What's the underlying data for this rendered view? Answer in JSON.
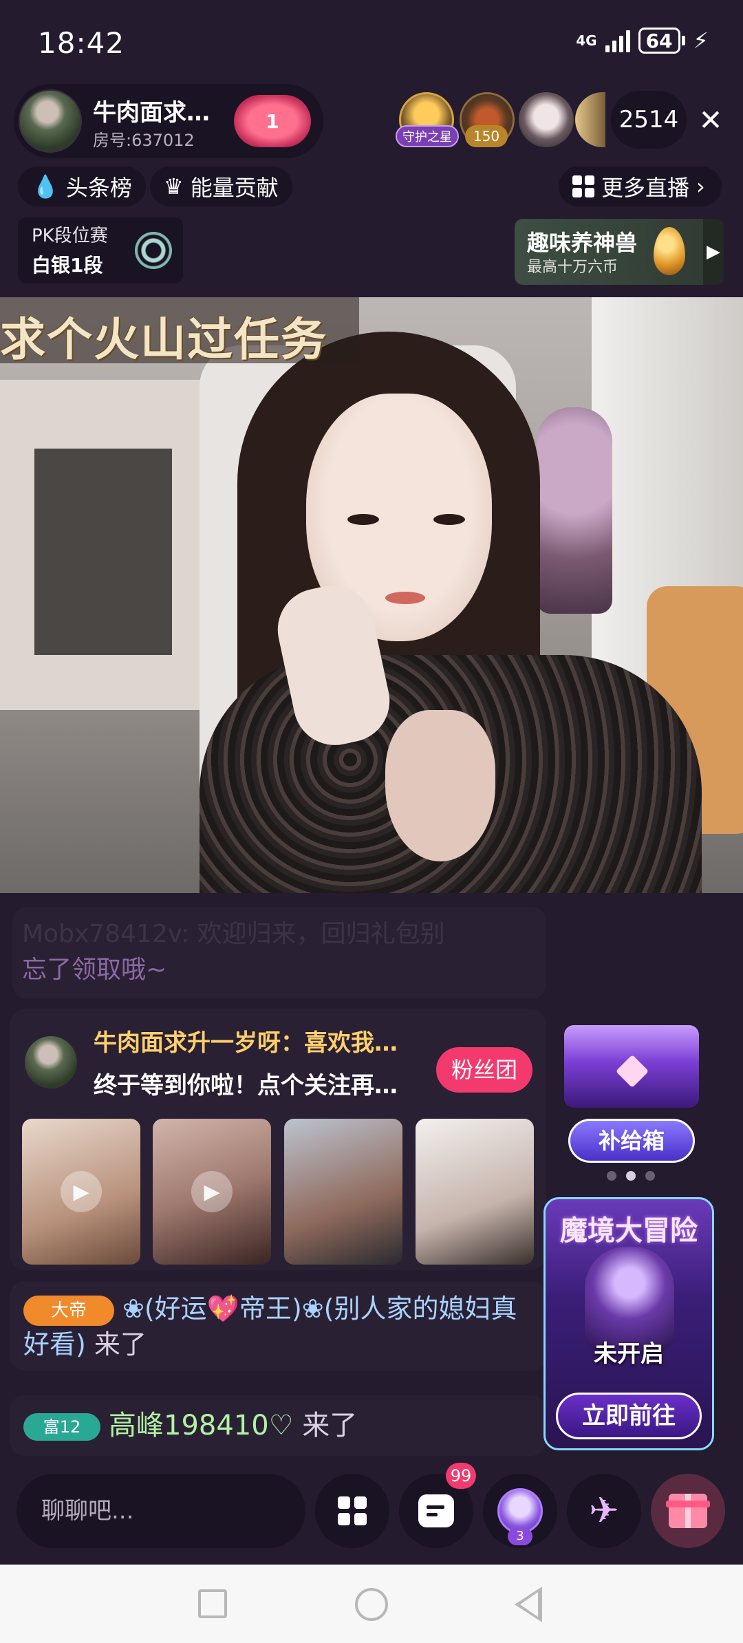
{
  "status_bar": {
    "time": "18:42",
    "network": "4G",
    "battery": "64"
  },
  "streamer": {
    "name": "牛肉面求…",
    "room_id": "房号:637012",
    "heart_count": "1"
  },
  "viewers": {
    "guardian_tag": "守护之星",
    "rank_tag": "150",
    "count": "2514"
  },
  "chips": {
    "headline": "头条榜",
    "energy": "能量贡献",
    "more_live": "更多直播"
  },
  "pk": {
    "title": "PK段位赛",
    "rank": "白银1段"
  },
  "game_promo": {
    "title": "趣味养神兽",
    "subtitle": "最高十万六币"
  },
  "stream_banner": "求个火山过任务",
  "chat": {
    "system_user": "Mobx78412v: ",
    "system_text_1": "欢迎归来，回归礼包别",
    "system_text_2": "忘了领取哦~",
    "anchor_card": {
      "line1": "牛肉面求升一岁呀：喜欢我…",
      "line2": "终于等到你啦！点个关注再…",
      "fans_button": "粉丝团"
    },
    "entry1": {
      "badge": "大帝",
      "nickname": "❀(好运💖帝王)❀(别人家的媳妇真好看)",
      "action": " 来了"
    },
    "entry2": {
      "badge": "富12",
      "nickname": "高峰198410♡",
      "action": " 来了"
    }
  },
  "promos": {
    "supply_box": "补给箱",
    "adventure_title": "魔境大冒险",
    "adventure_status": "未开启",
    "adventure_button": "立即前往"
  },
  "toolbar": {
    "chat_placeholder": "聊聊吧...",
    "unread_count": "99",
    "avatar_level": "3"
  },
  "icons": {
    "close": "close-icon",
    "flame": "flame-icon",
    "crown": "crown-icon",
    "grid": "grid-icon",
    "chevron": "chevron-right-icon",
    "play": "play-icon",
    "message": "message-icon",
    "crane": "paper-crane-icon",
    "gift": "gift-icon"
  },
  "colors": {
    "background": "#241b2e",
    "accent_pink": "#f23a6e",
    "gold_name": "#ffd06a",
    "nickname_blue": "#a9d2ff",
    "nickname_green": "#b2f2a2"
  }
}
